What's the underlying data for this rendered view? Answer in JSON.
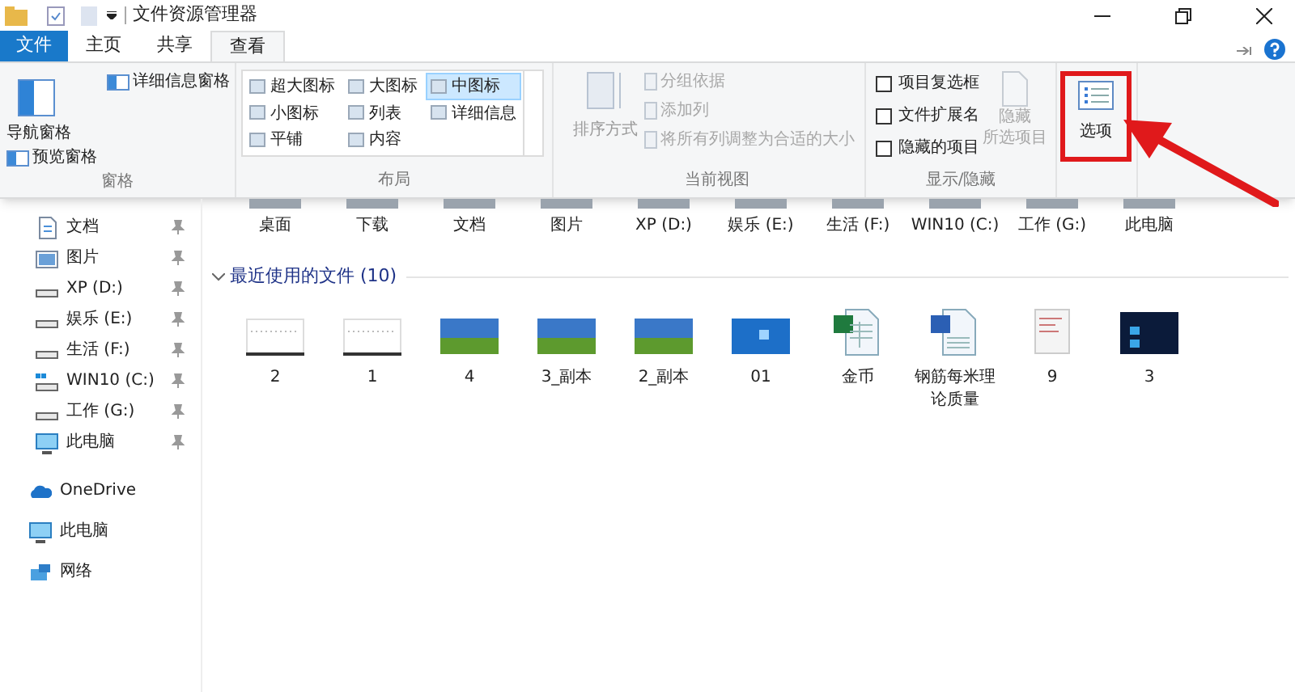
{
  "window": {
    "title": "文件资源管理器"
  },
  "tabs": [
    {
      "label": "文件",
      "kind": "file",
      "selected": false
    },
    {
      "label": "主页",
      "kind": "tab",
      "selected": false
    },
    {
      "label": "共享",
      "kind": "tab",
      "selected": false
    },
    {
      "label": "查看",
      "kind": "tab",
      "selected": true
    }
  ],
  "ribbon": {
    "groups": [
      {
        "kind": "panes",
        "label": "窗格",
        "nav_pane": "导航窗格",
        "items": [
          "预览窗格",
          "详细信息窗格"
        ]
      },
      {
        "kind": "layout",
        "label": "布局",
        "options": [
          {
            "label": "超大图标",
            "selected": false
          },
          {
            "label": "小图标",
            "selected": false
          },
          {
            "label": "平铺",
            "selected": false
          },
          {
            "label": "大图标",
            "selected": false
          },
          {
            "label": "列表",
            "selected": false
          },
          {
            "label": "内容",
            "selected": false
          },
          {
            "label": "中图标",
            "selected": true
          },
          {
            "label": "详细信息",
            "selected": false
          }
        ]
      },
      {
        "kind": "view",
        "label": "当前视图",
        "sort": "排序方式",
        "items": [
          {
            "label": "分组依据",
            "disabled": true
          },
          {
            "label": "添加列",
            "disabled": true
          },
          {
            "label": "将所有列调整为合适的大小",
            "disabled": true
          }
        ]
      },
      {
        "kind": "showhide",
        "label": "显示/隐藏",
        "checkboxes": [
          {
            "label": "项目复选框",
            "checked": false
          },
          {
            "label": "文件扩展名",
            "checked": false
          },
          {
            "label": "隐藏的项目",
            "checked": false
          }
        ],
        "hide_button": {
          "lines": [
            "隐藏",
            "所选项目"
          ],
          "disabled": true
        }
      },
      {
        "kind": "options",
        "label": "选项",
        "highlighted": true
      }
    ]
  },
  "sidebar": {
    "items": [
      {
        "label": "文档",
        "kind": "doc",
        "pinned": true
      },
      {
        "label": "图片",
        "kind": "pictures",
        "pinned": true
      },
      {
        "label": "XP (D:)",
        "kind": "drive",
        "pinned": true
      },
      {
        "label": "娱乐 (E:)",
        "kind": "drive",
        "pinned": true
      },
      {
        "label": "生活 (F:)",
        "kind": "drive",
        "pinned": true
      },
      {
        "label": "WIN10 (C:)",
        "kind": "sysdrive",
        "pinned": true
      },
      {
        "label": "工作 (G:)",
        "kind": "drive",
        "pinned": true
      },
      {
        "label": "此电脑",
        "kind": "pc",
        "pinned": true
      },
      {
        "label": "OneDrive",
        "kind": "cloud",
        "pinned": false
      },
      {
        "label": "此电脑",
        "kind": "pc",
        "pinned": false
      },
      {
        "label": "网络",
        "kind": "network",
        "pinned": false
      }
    ]
  },
  "folders": [
    "桌面",
    "下载",
    "文档",
    "图片",
    "XP (D:)",
    "娱乐 (E:)",
    "生活 (F:)",
    "WIN10 (C:)",
    "工作 (G:)",
    "此电脑"
  ],
  "recent": {
    "title": "最近使用的文件 (10)",
    "expanded": true,
    "files": [
      {
        "name": "2",
        "kind": "screenshot"
      },
      {
        "name": "1",
        "kind": "screenshot"
      },
      {
        "name": "4",
        "kind": "photo"
      },
      {
        "name": "3_副本",
        "kind": "photo"
      },
      {
        "name": "2_副本",
        "kind": "photo"
      },
      {
        "name": "01",
        "kind": "desktop"
      },
      {
        "name": "金币",
        "kind": "excel"
      },
      {
        "name": "钢筋每米理论质量",
        "kind": "word"
      },
      {
        "name": "9",
        "kind": "dialog"
      },
      {
        "name": "3",
        "kind": "dark"
      }
    ]
  }
}
